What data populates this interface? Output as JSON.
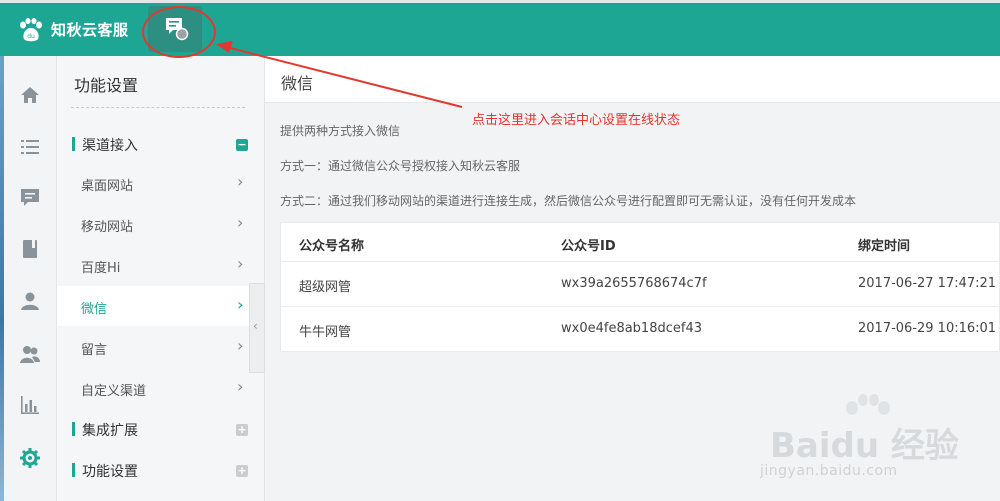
{
  "brand": "知秋云客服",
  "sidebar_title": "功能设置",
  "groups": [
    {
      "label": "渠道接入",
      "toggle": "−"
    },
    {
      "label": "集成扩展",
      "toggle": "+"
    },
    {
      "label": "功能设置",
      "toggle": "+"
    }
  ],
  "channel_items": [
    {
      "label": "桌面网站",
      "chevron": "›"
    },
    {
      "label": "移动网站",
      "chevron": "›"
    },
    {
      "label": "百度Hi",
      "chevron": "›"
    },
    {
      "label": "微信",
      "chevron": "›"
    },
    {
      "label": "留言",
      "chevron": "›"
    },
    {
      "label": "自定义渠道",
      "chevron": "›"
    }
  ],
  "collapse_glyph": "‹",
  "main": {
    "title": "微信",
    "desc1": "提供两种方式接入微信",
    "desc2": "方式一：通过微信公众号授权接入知秋云客服",
    "desc3": "方式二：通过我们移动网站的渠道进行连接生成，然后微信公众号进行配置即可无需认证，没有任何开发成本"
  },
  "table": {
    "headers": [
      "公众号名称",
      "公众号ID",
      "绑定时间"
    ],
    "rows": [
      [
        "超级网管",
        "wx39a2655768674c7f",
        "2017-06-27 17:47:21"
      ],
      [
        "牛牛网管",
        "wx0e4fe8ab18dcef43",
        "2017-06-29 10:16:01"
      ]
    ]
  },
  "annotation": "点击这里进入会话中心设置在线状态",
  "watermark": {
    "main": "Baidu 经验",
    "sub": "jingyan.baidu.com"
  },
  "icons": {
    "logo": "baidu-paw-icon",
    "chat": "chat-status-icon",
    "rail": [
      "home-icon",
      "list-icon",
      "message-icon",
      "book-icon",
      "user-icon",
      "users-icon",
      "chart-icon",
      "gear-icon"
    ]
  },
  "colors": {
    "accent": "#1ea695",
    "annotation": "#e8332b"
  }
}
